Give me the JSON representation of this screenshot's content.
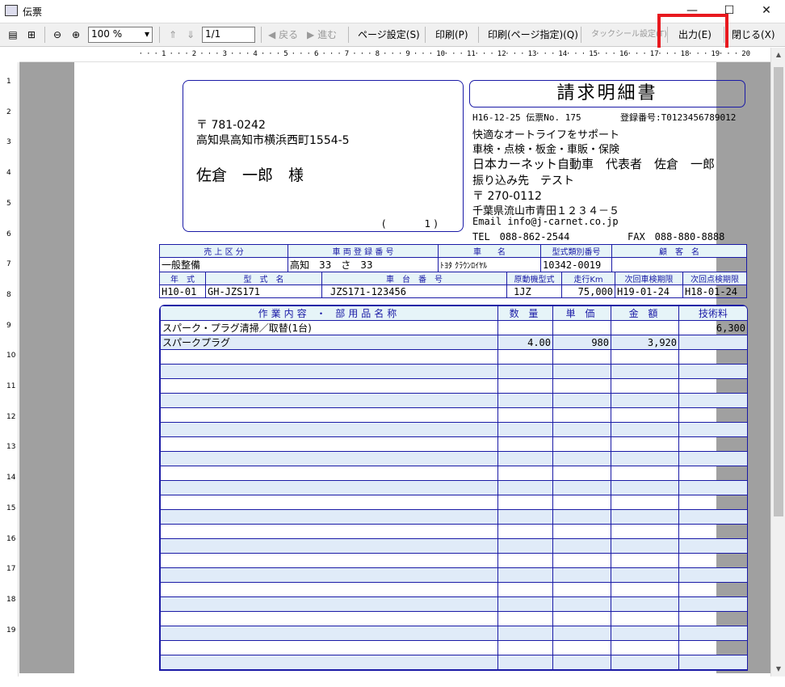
{
  "window": {
    "title": "伝票",
    "minimize": "—",
    "maximize": "☐",
    "close": "✕"
  },
  "toolbar": {
    "zoom": "100 %",
    "page": "1/1",
    "back": "戻る",
    "forward": "進む",
    "page_setup": "ページ設定(S)",
    "print": "印刷(P)",
    "print_pages": "印刷(ページ指定)(Q)",
    "tack_seal": "タックシール設定(T)",
    "output": "出力(E)",
    "close": "閉じる(X)"
  },
  "ruler": {
    "h_labels": [
      "1",
      "2",
      "3",
      "4",
      "5",
      "6",
      "7",
      "8",
      "9",
      "10",
      "11",
      "12",
      "13",
      "14",
      "15",
      "16",
      "17",
      "18",
      "19",
      "20"
    ],
    "v_labels": [
      "1",
      "2",
      "3",
      "4",
      "5",
      "6",
      "7",
      "8",
      "9",
      "10",
      "11",
      "12",
      "13",
      "14",
      "15",
      "16",
      "17",
      "18",
      "19"
    ]
  },
  "invoice": {
    "title": "請求明細書",
    "recipient": {
      "postal": "〒 781-0242",
      "address": "高知県高知市横浜西町1554-5",
      "name": "佐倉　一郎　様",
      "page_no": "(　　　　1 )"
    },
    "date_slip": "H16-12-25 伝票No. 175",
    "registration": "登録番号:T0123456789012",
    "company": {
      "tagline1": "快適なオートライフをサポート",
      "tagline2": "車検・点検・板金・車販・保険",
      "name": "日本カーネット自動車　代表者　佐倉　一郎",
      "bank": "振り込み先　テスト",
      "postal": "〒 270-0112",
      "address": "千葉県流山市青田１２３４－５",
      "email": "Email info@j-carnet.co.jp",
      "tel": "TEL　088-862-2544",
      "fax": "FAX　088-880-8888"
    },
    "vehicle_headers1": [
      "売 上 区 分",
      "車 両 登 録 番 号",
      "車　　名",
      "型式類別番号",
      "顧　客　名"
    ],
    "vehicle_values1": [
      "一般整備",
      "高知　33　さ　33",
      "ﾄﾖﾀ ｸﾗｳﾝﾛｲﾔﾙ",
      "10342-0019",
      ""
    ],
    "vehicle_headers2": [
      "年　式",
      "型　式　名",
      "車　台　番　号",
      "原動機型式",
      "走行Km",
      "次回車検期限",
      "次回点検期限"
    ],
    "vehicle_values2": [
      "H10-01",
      "GH-JZS171",
      "JZS171-123456",
      "1JZ",
      "75,000",
      "H19-01-24",
      "H18-01-24"
    ],
    "work_headers": [
      "作業内容 ・ 部用品名称",
      "数 量",
      "単 価",
      "金 額",
      "技術料"
    ],
    "work_rows": [
      [
        "スパーク・プラグ清掃／取替(1台)",
        "",
        "",
        "",
        "6,300"
      ],
      [
        "スパークプラグ",
        "4.00",
        "980",
        "3,920",
        ""
      ]
    ]
  }
}
